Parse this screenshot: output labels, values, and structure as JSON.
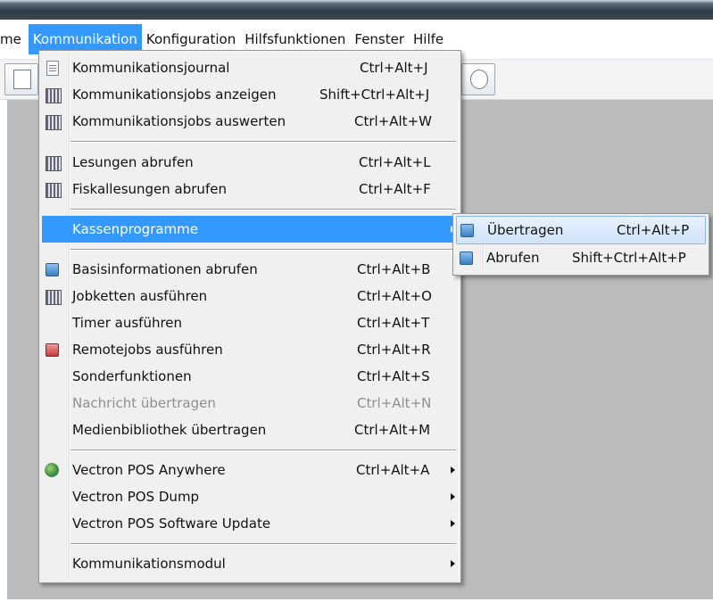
{
  "menubar": {
    "items": [
      {
        "label": "me"
      },
      {
        "label": "Kommunikation"
      },
      {
        "label": "Konfiguration"
      },
      {
        "label": "Hilfsfunktionen"
      },
      {
        "label": "Fenster"
      },
      {
        "label": "Hilfe"
      }
    ]
  },
  "main_menu": {
    "items": [
      {
        "label": "Kommunikationsjournal",
        "shortcut": "Ctrl+Alt+J",
        "icon": "journal-icon"
      },
      {
        "label": "Kommunikationsjobs anzeigen",
        "shortcut": "Shift+Ctrl+Alt+J",
        "icon": "jobs-view-icon"
      },
      {
        "label": "Kommunikationsjobs auswerten",
        "shortcut": "Ctrl+Alt+W",
        "icon": "jobs-evaluate-icon"
      },
      {
        "label": "Lesungen abrufen",
        "shortcut": "Ctrl+Alt+L",
        "icon": "readings-icon"
      },
      {
        "label": "Fiskallesungen abrufen",
        "shortcut": "Ctrl+Alt+F",
        "icon": "fiscal-readings-icon"
      },
      {
        "label": "Kassenprogramme",
        "shortcut": "",
        "icon": ""
      },
      {
        "label": "Basisinformationen abrufen",
        "shortcut": "Ctrl+Alt+B",
        "icon": "base-info-icon"
      },
      {
        "label": "Jobketten ausführen",
        "shortcut": "Ctrl+Alt+O",
        "icon": "job-chain-icon"
      },
      {
        "label": "Timer ausführen",
        "shortcut": "Ctrl+Alt+T",
        "icon": ""
      },
      {
        "label": "Remotejobs ausführen",
        "shortcut": "Ctrl+Alt+R",
        "icon": "remote-jobs-icon"
      },
      {
        "label": "Sonderfunktionen",
        "shortcut": "Ctrl+Alt+S",
        "icon": ""
      },
      {
        "label": "Nachricht übertragen",
        "shortcut": "Ctrl+Alt+N",
        "icon": ""
      },
      {
        "label": "Medienbibliothek übertragen",
        "shortcut": "Ctrl+Alt+M",
        "icon": ""
      },
      {
        "label": "Vectron POS Anywhere",
        "shortcut": "Ctrl+Alt+A",
        "icon": "pos-anywhere-icon"
      },
      {
        "label": "Vectron POS Dump",
        "shortcut": "",
        "icon": ""
      },
      {
        "label": "Vectron POS Software Update",
        "shortcut": "",
        "icon": ""
      },
      {
        "label": "Kommunikationsmodul",
        "shortcut": "",
        "icon": ""
      }
    ]
  },
  "submenu": {
    "items": [
      {
        "label": "Übertragen",
        "shortcut": "Ctrl+Alt+P",
        "icon": "upload-program-icon"
      },
      {
        "label": "Abrufen",
        "shortcut": "Shift+Ctrl+Alt+P",
        "icon": "download-program-icon"
      }
    ]
  }
}
